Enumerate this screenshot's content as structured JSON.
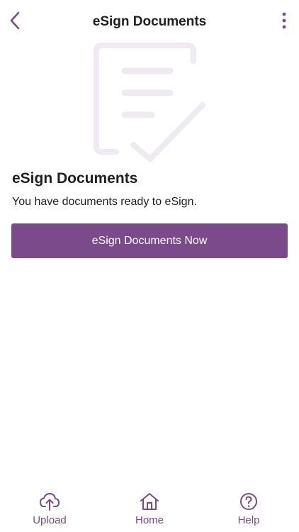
{
  "header": {
    "title": "eSign Documents",
    "back_icon": "chevron-left-icon",
    "more_icon": "more-vertical-icon"
  },
  "illustration": {
    "icon": "document-checkmark-icon"
  },
  "content": {
    "heading": "eSign Documents",
    "message": "You have documents ready to eSign.",
    "button_label": "eSign Documents Now"
  },
  "nav": {
    "items": [
      {
        "label": "Upload",
        "icon": "cloud-upload-icon"
      },
      {
        "label": "Home",
        "icon": "home-icon"
      },
      {
        "label": "Help",
        "icon": "help-circle-icon"
      }
    ]
  },
  "colors": {
    "accent": "#7b4a8b",
    "illustration": "#efe9f2",
    "text": "#1f1f1f",
    "background": "#ffffff"
  }
}
